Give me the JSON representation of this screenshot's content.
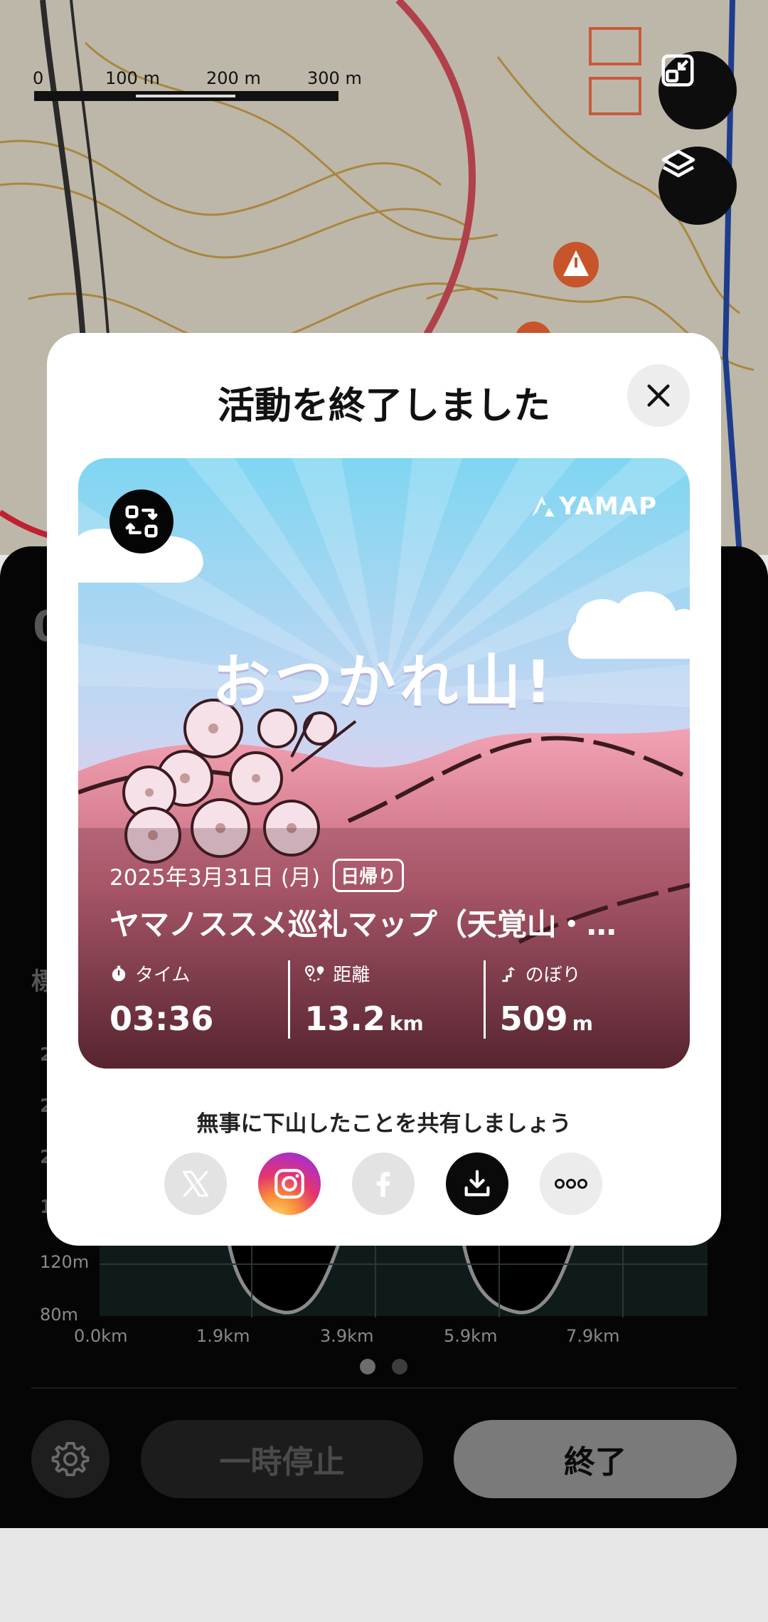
{
  "map": {
    "scale_labels": [
      "0",
      "100 m",
      "200 m",
      "300 m"
    ],
    "buttons": [
      {
        "name": "fullscreen-exit",
        "icon": "fullscreen-exit-icon"
      },
      {
        "name": "layers",
        "icon": "layers-icon"
      }
    ]
  },
  "background_panel": {
    "partial_labels": [
      "0",
      "標",
      "2",
      "2",
      "2",
      "1"
    ],
    "y_ticks": [
      "120m",
      "80m"
    ],
    "x_ticks": [
      "0.0km",
      "1.9km",
      "3.9km",
      "5.9km",
      "7.9km"
    ],
    "page_dots": 2,
    "pause_label": "一時停止",
    "end_label": "終了",
    "settings_icon": "gear-icon"
  },
  "modal": {
    "title": "活動を終了しました",
    "close_icon": "close-icon",
    "card": {
      "swap_icon": "swap-template-icon",
      "brand": "YAMAP",
      "headline": "おつかれ山!",
      "date": "2025年3月31日 (月)",
      "badge": "日帰り",
      "route_title": "ヤマノススメ巡礼マップ（天覚山・…",
      "stats": [
        {
          "label": "タイム",
          "icon": "stopwatch-icon",
          "value": "03:36",
          "unit": ""
        },
        {
          "label": "距離",
          "icon": "route-pin-icon",
          "value": "13.2",
          "unit": "km"
        },
        {
          "label": "のぼり",
          "icon": "ascent-icon",
          "value": "509",
          "unit": "m"
        }
      ]
    },
    "share_caption": "無事に下山したことを共有しましょう",
    "share_buttons": [
      "x-icon",
      "instagram-icon",
      "facebook-icon",
      "download-icon",
      "more-icon"
    ]
  },
  "colors": {
    "card_sky_top": "#7fd6f2",
    "card_sky_mid": "#e6c8ec",
    "card_mountain": "#f1a0b0",
    "card_bottom": "#5d2a35",
    "end_button": "#7a7a7a"
  }
}
